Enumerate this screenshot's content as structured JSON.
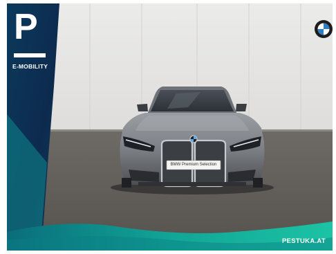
{
  "branding": {
    "logo_letter": "P",
    "logo_caption": "E-MOBILITY",
    "website": "PESTUKA.AT",
    "plate_text": "BMW Premium Selection",
    "manufacturer_emblem": "bmw-roundel"
  },
  "scene": {
    "subject": "bmw-i4-front-view",
    "car_color": "#8a8d92",
    "wall_color": "#e6e6e4",
    "ground_color": "#5f5c58",
    "accent_teal": "#0f9d96",
    "accent_navy": "#0d2f55"
  }
}
